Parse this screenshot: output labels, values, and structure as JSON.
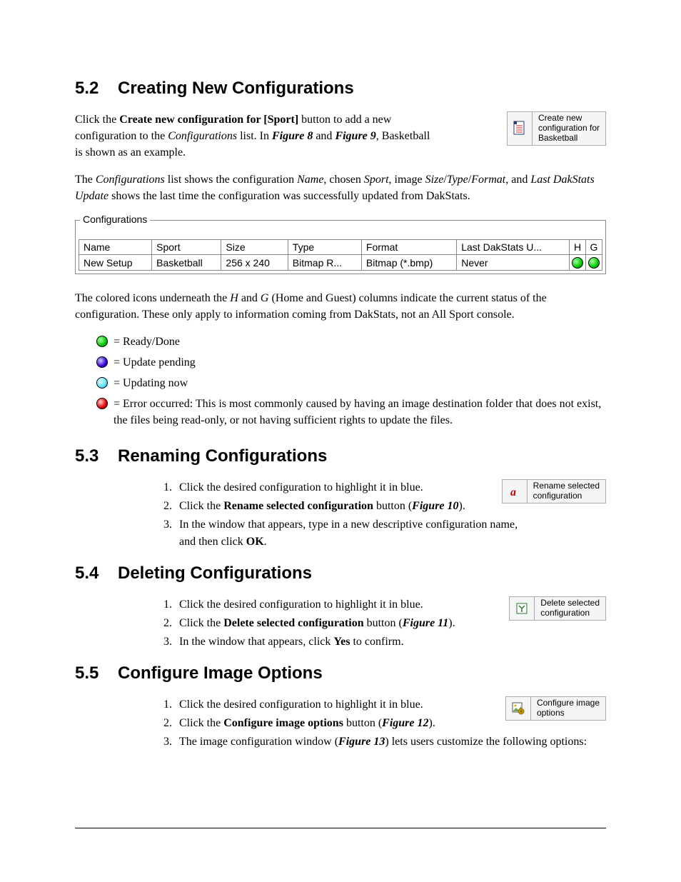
{
  "sec52": {
    "num": "5.2",
    "title": "Creating New Configurations",
    "btn_line1": "Create new",
    "btn_line2": "configuration for",
    "btn_line3": "Basketball",
    "p1_a": "Click the ",
    "p1_b": "Create new configuration for [Sport]",
    "p1_c": " button to add a new configuration to the ",
    "p1_d": "Configurations",
    "p1_e": " list. In ",
    "p1_f": "Figure 8",
    "p1_g": " and ",
    "p1_h": "Figure 9",
    "p1_i": ", Basketball is shown as an example.",
    "p2_a": "The ",
    "p2_b": "Configurations",
    "p2_c": " list shows the configuration ",
    "p2_d": "Name",
    "p2_e": ", chosen ",
    "p2_f": "Sport",
    "p2_g": ", image ",
    "p2_h": "Size",
    "p2_i": "/",
    "p2_j": "Type",
    "p2_k": "/",
    "p2_l": "Format",
    "p2_m": ", and ",
    "p2_n": "Last DakStats Update",
    "p2_o": " shows the last time the configuration was successfully updated from DakStats."
  },
  "cfg": {
    "legend": "Configurations",
    "headers": [
      "Name",
      "Sport",
      "Size",
      "Type",
      "Format",
      "Last DakStats U...",
      "H",
      "G"
    ],
    "row": [
      "New Setup",
      "Basketball",
      "256 x 240",
      "Bitmap R...",
      "Bitmap (*.bmp)",
      "Never"
    ]
  },
  "status": {
    "intro_a": "The colored icons underneath the ",
    "intro_b": "H",
    "intro_c": " and ",
    "intro_d": "G",
    "intro_e": " (Home and Guest) columns indicate the current status of the configuration. These only apply to information coming from DakStats, not an All Sport console.",
    "ready": "= Ready/Done",
    "pending": "= Update pending",
    "updating": "= Updating now",
    "error": "= Error occurred: This is most commonly caused by having an image destination folder that does not exist, the files being read-only, or not having sufficient rights to update the files."
  },
  "sec53": {
    "num": "5.3",
    "title": "Renaming Configurations",
    "btn_line1": "Rename selected",
    "btn_line2": "configuration",
    "s1": "Click the desired configuration to highlight it in blue.",
    "s2_a": "Click the ",
    "s2_b": "Rename selected configuration",
    "s2_c": " button (",
    "s2_d": "Figure 10",
    "s2_e": ").",
    "s3_a": "In the window that appears, type in a new descriptive configuration name, and then click ",
    "s3_b": "OK",
    "s3_c": "."
  },
  "sec54": {
    "num": "5.4",
    "title": "Deleting Configurations",
    "btn_line1": "Delete selected",
    "btn_line2": "configuration",
    "s1": "Click the desired configuration to highlight it in blue.",
    "s2_a": "Click the ",
    "s2_b": "Delete selected configuration",
    "s2_c": " button (",
    "s2_d": "Figure 11",
    "s2_e": ").",
    "s3_a": "In the window that appears, click ",
    "s3_b": "Yes",
    "s3_c": " to confirm."
  },
  "sec55": {
    "num": "5.5",
    "title": "Configure Image Options",
    "btn_line1": "Configure image",
    "btn_line2": "options",
    "s1": "Click the desired configuration to highlight it in blue.",
    "s2_a": "Click the ",
    "s2_b": "Configure image options",
    "s2_c": " button (",
    "s2_d": "Figure 12",
    "s2_e": ").",
    "s3_a": "The image configuration window (",
    "s3_b": "Figure 13",
    "s3_c": ") lets users customize the following options:"
  }
}
